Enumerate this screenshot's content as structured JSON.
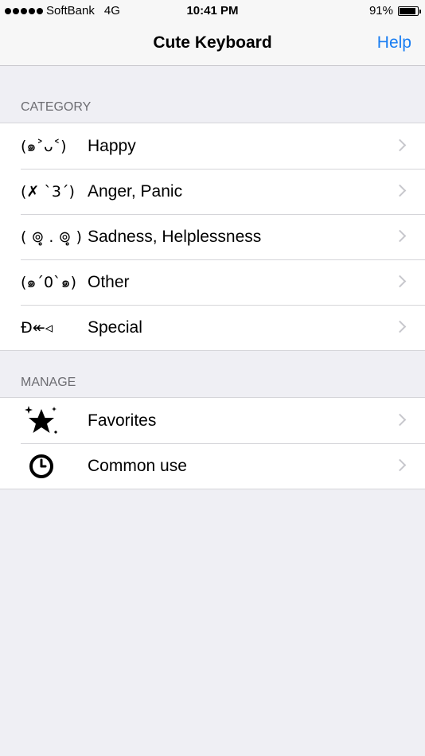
{
  "status_bar": {
    "carrier": "SoftBank",
    "network": "4G",
    "time": "10:41 PM",
    "battery": "91%",
    "battery_level": 0.91
  },
  "nav": {
    "title": "Cute Keyboard",
    "help_label": "Help"
  },
  "category": {
    "header": "CATEGORY",
    "items": [
      {
        "icon": "(๑˃ᴗ˂)",
        "label": "Happy"
      },
      {
        "icon": "(✗ `3´)",
        "label": "Anger, Panic"
      },
      {
        "icon": "( ⊚̥̥̥ . ⊚̥̥̥ )",
        "label": "Sadness, Helplessness"
      },
      {
        "icon": "(๑´0`๑)",
        "label": "Other"
      },
      {
        "icon": "Ð↞◃",
        "label": "Special"
      }
    ]
  },
  "manage": {
    "header": "MANAGE",
    "items": [
      {
        "icon": "star-sparkle-icon",
        "label": "Favorites"
      },
      {
        "icon": "clock-icon",
        "label": "Common use"
      }
    ]
  },
  "colors": {
    "accent": "#1a7ef2",
    "background": "#efeff4"
  }
}
